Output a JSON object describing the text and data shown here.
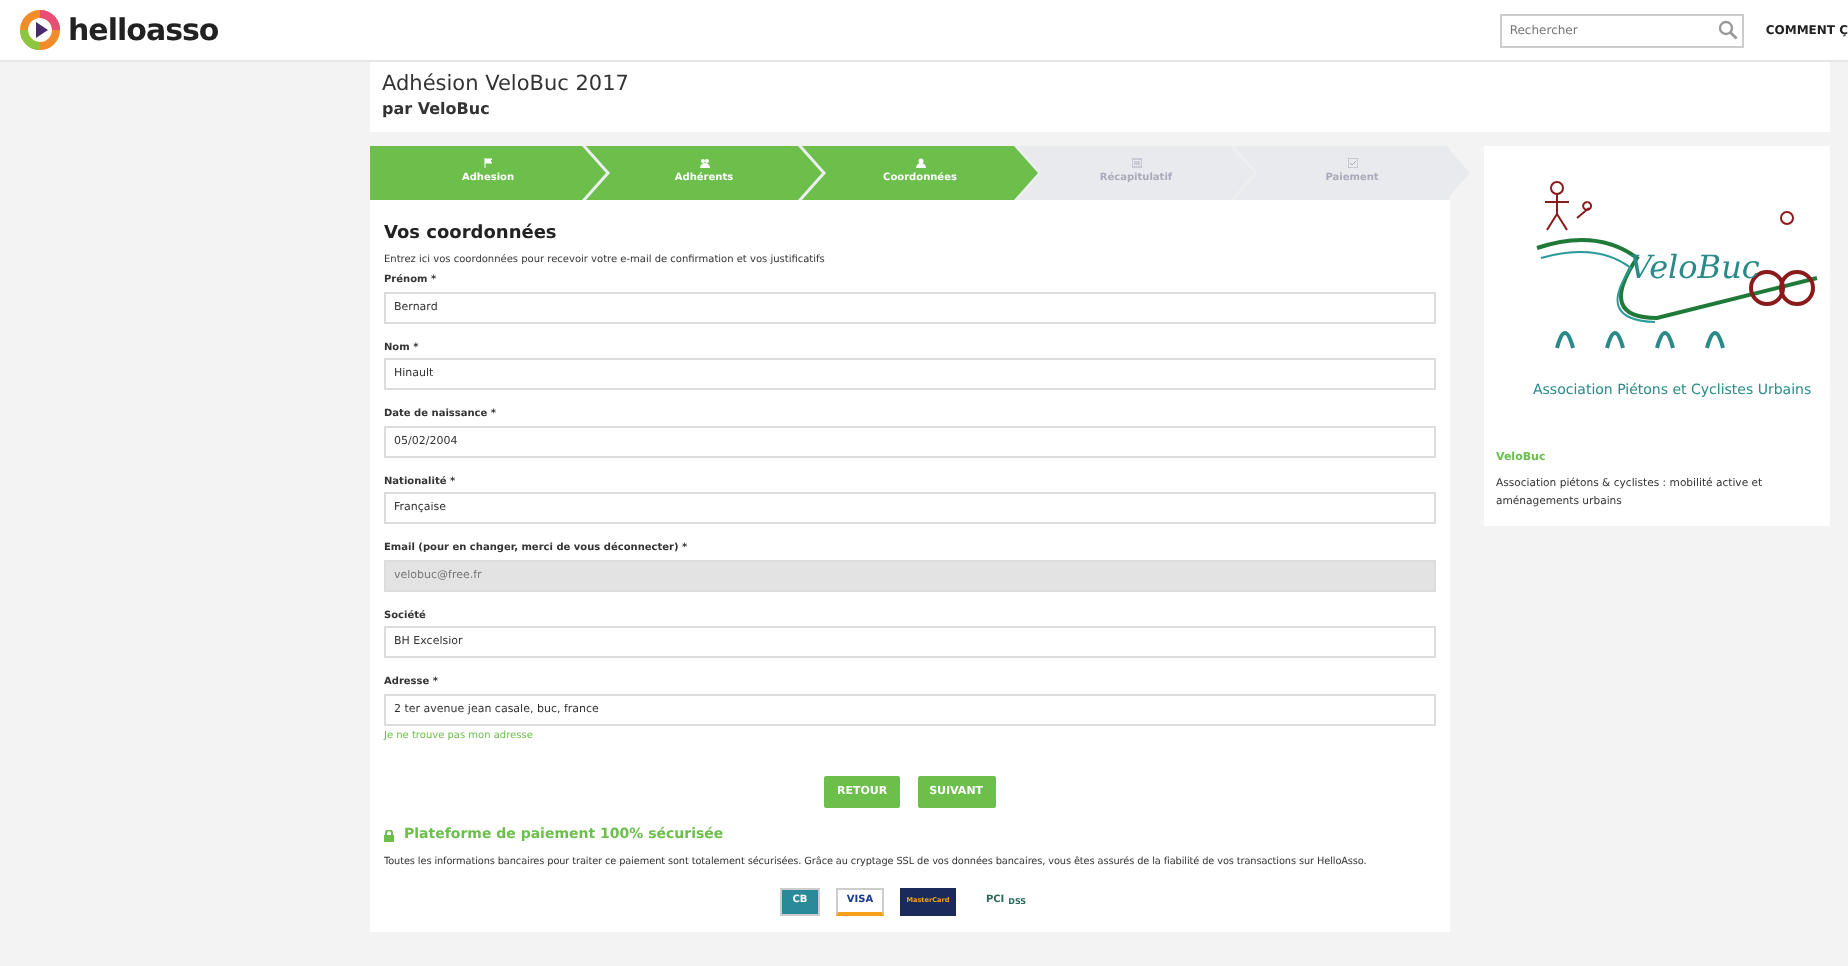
{
  "header": {
    "brand": "helloasso",
    "search": {
      "placeholder": "Rechercher"
    },
    "menu_link": "COMMENT Ç"
  },
  "page": {
    "title": "Adhésion VeloBuc 2017",
    "by": "par",
    "organizer": "VeloBuc"
  },
  "steps": [
    {
      "label": "Adhesion",
      "done": true
    },
    {
      "label": "Adhérents",
      "done": true
    },
    {
      "label": "Coordonnées",
      "done": true
    },
    {
      "label": "Récapitulatif",
      "done": false
    },
    {
      "label": "Paiement",
      "done": false
    }
  ],
  "form": {
    "title": "Vos coordonnées",
    "intro": "Entrez ici vos coordonnées pour recevoir votre e-mail de confirmation et vos justificatifs",
    "fields": [
      {
        "label": "Prénom *",
        "value": "Bernard",
        "disabled": false
      },
      {
        "label": "Nom *",
        "value": "Hinault",
        "disabled": false
      },
      {
        "label": "Date de naissance *",
        "value": "05/02/2004",
        "disabled": false
      },
      {
        "label": "Nationalité *",
        "value": "Française",
        "disabled": false
      },
      {
        "label": "Email (pour en changer, merci de vous déconnecter) *",
        "value": "velobuc@free.fr",
        "disabled": true
      },
      {
        "label": "Société",
        "value": "BH Excelsior",
        "disabled": false
      },
      {
        "label": "Adresse *",
        "value": "2 ter avenue jean casale, buc, france",
        "disabled": false,
        "help_link": "Je ne trouve pas mon adresse"
      }
    ],
    "buttons": [
      "RETOUR",
      "SUIVANT"
    ]
  },
  "security": {
    "title": "Plateforme de paiement 100% sécurisée",
    "text": "Toutes les informations bancaires pour traiter ce paiement sont totalement sécurisées. Grâce au cryptage SSL de vos données bancaires, vous êtes assurés de la fiabilité de vos transactions sur HelloAsso.",
    "cards": [
      {
        "kind": "cb",
        "label": "CB"
      },
      {
        "kind": "visa",
        "label": "VISA"
      },
      {
        "kind": "mastercard",
        "label": "MasterCard"
      },
      {
        "kind": "pci",
        "label": "PCI",
        "sub": "DSS"
      }
    ]
  },
  "organization": {
    "logo_name": "VeloBuc",
    "logo_tagline": "Association Piétons et Cyclistes Urbains",
    "name": "VeloBuc",
    "description": "Association piétons & cyclistes : mobilité active et aménagements urbains"
  }
}
